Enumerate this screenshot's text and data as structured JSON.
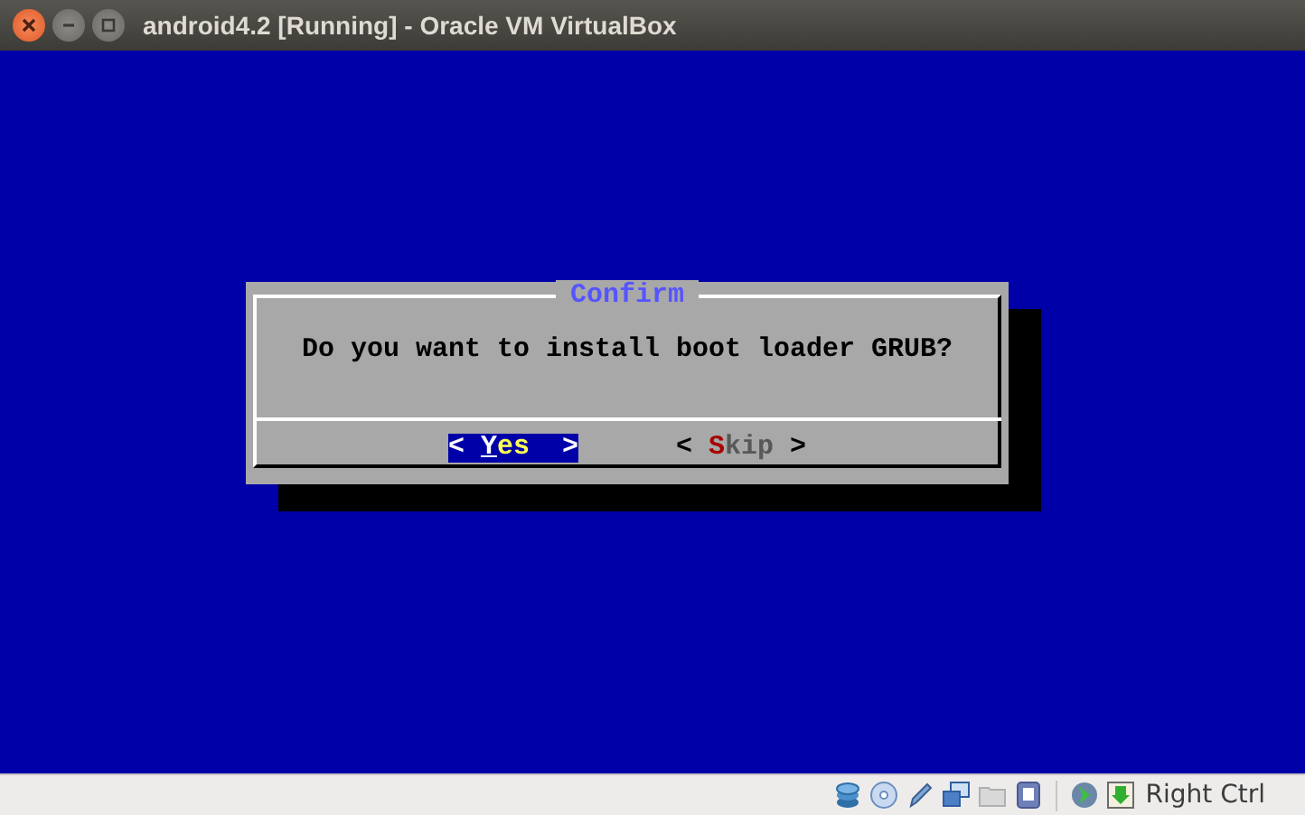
{
  "window": {
    "title": "android4.2 [Running] - Oracle VM VirtualBox"
  },
  "dialog": {
    "title": "Confirm",
    "message": "Do you want to install boot loader GRUB?",
    "buttons": [
      {
        "open": "<",
        "label": "Yes",
        "close": ">",
        "selected": true
      },
      {
        "open": "<",
        "label": "Skip",
        "close": ">",
        "selected": false
      }
    ]
  },
  "status_bar": {
    "host_key": "Right Ctrl"
  }
}
